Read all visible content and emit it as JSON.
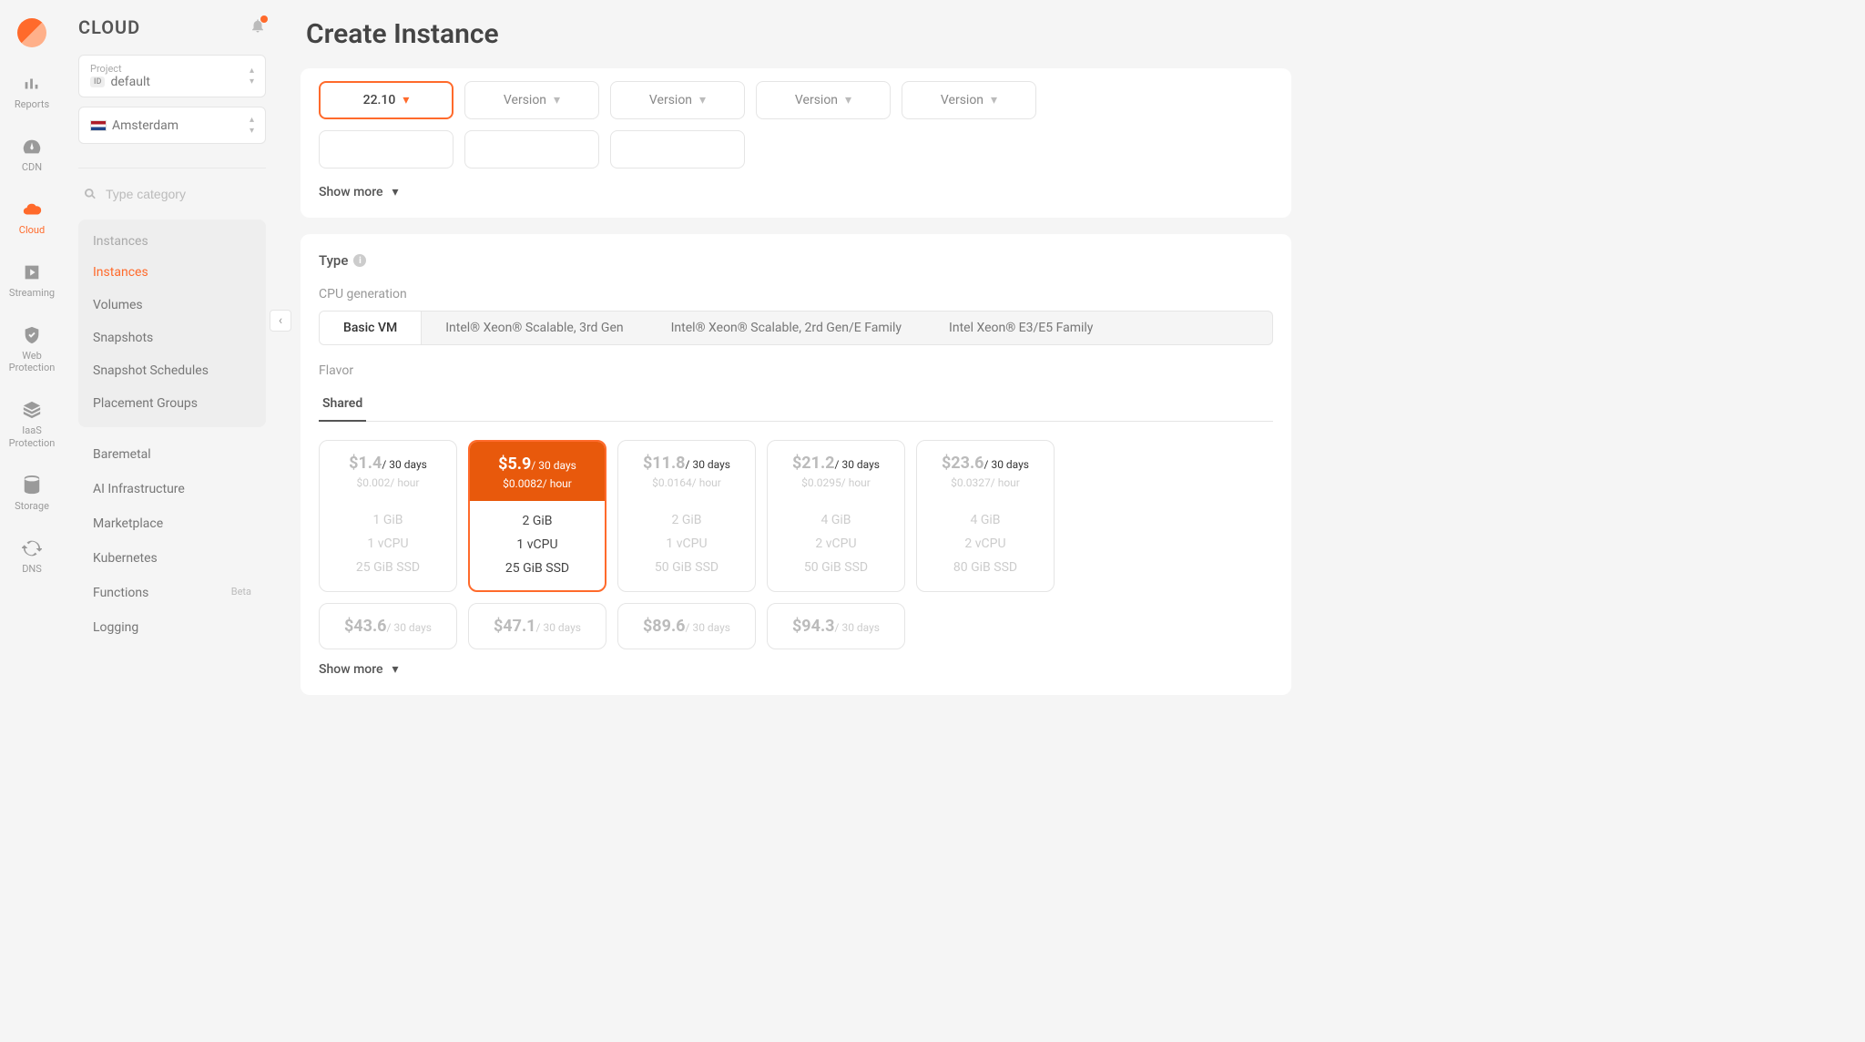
{
  "rail": [
    {
      "label": "Reports"
    },
    {
      "label": "CDN"
    },
    {
      "label": "Cloud"
    },
    {
      "label": "Streaming"
    },
    {
      "label": "Web Protection"
    },
    {
      "label": "IaaS Protection"
    },
    {
      "label": "Storage"
    },
    {
      "label": "DNS"
    }
  ],
  "sidebar": {
    "title": "CLOUD",
    "project_label": "Project",
    "project_value": "default",
    "id_badge": "ID",
    "region": "Amsterdam",
    "search_placeholder": "Type category",
    "group_title": "Instances",
    "group_items": [
      "Instances",
      "Volumes",
      "Snapshots",
      "Snapshot Schedules",
      "Placement Groups"
    ],
    "nav_items": [
      "Baremetal",
      "AI Infrastructure",
      "Marketplace",
      "Kubernetes",
      "Functions",
      "Logging"
    ],
    "beta": "Beta"
  },
  "page": {
    "title": "Create Instance",
    "version_selected": "22.10",
    "version_label": "Version",
    "show_more": "Show more",
    "type_label": "Type",
    "cpu_gen_label": "CPU generation",
    "cpu_tabs": [
      "Basic VM",
      "Intel® Xeon® Scalable, 3rd Gen",
      "Intel® Xeon® Scalable, 2rd Gen/E Family",
      "Intel Xeon® E3/E5 Family"
    ],
    "flavor_label": "Flavor",
    "flavor_tab": "Shared",
    "per30": "/ 30 days",
    "perhour": "/ hour",
    "flavors": [
      {
        "price": "$1.4",
        "hour": "$0.002",
        "ram": "1 GiB",
        "cpu": "1 vCPU",
        "ssd": "25 GiB SSD"
      },
      {
        "price": "$5.9",
        "hour": "$0.0082",
        "ram": "2 GiB",
        "cpu": "1 vCPU",
        "ssd": "25 GiB SSD"
      },
      {
        "price": "$11.8",
        "hour": "$0.0164",
        "ram": "2 GiB",
        "cpu": "1 vCPU",
        "ssd": "50 GiB SSD"
      },
      {
        "price": "$21.2",
        "hour": "$0.0295",
        "ram": "4 GiB",
        "cpu": "2 vCPU",
        "ssd": "50 GiB SSD"
      },
      {
        "price": "$23.6",
        "hour": "$0.0327",
        "ram": "4 GiB",
        "cpu": "2 vCPU",
        "ssd": "80 GiB SSD"
      }
    ],
    "flavors2": [
      {
        "price": "$43.6"
      },
      {
        "price": "$47.1"
      },
      {
        "price": "$89.6"
      },
      {
        "price": "$94.3"
      }
    ]
  }
}
